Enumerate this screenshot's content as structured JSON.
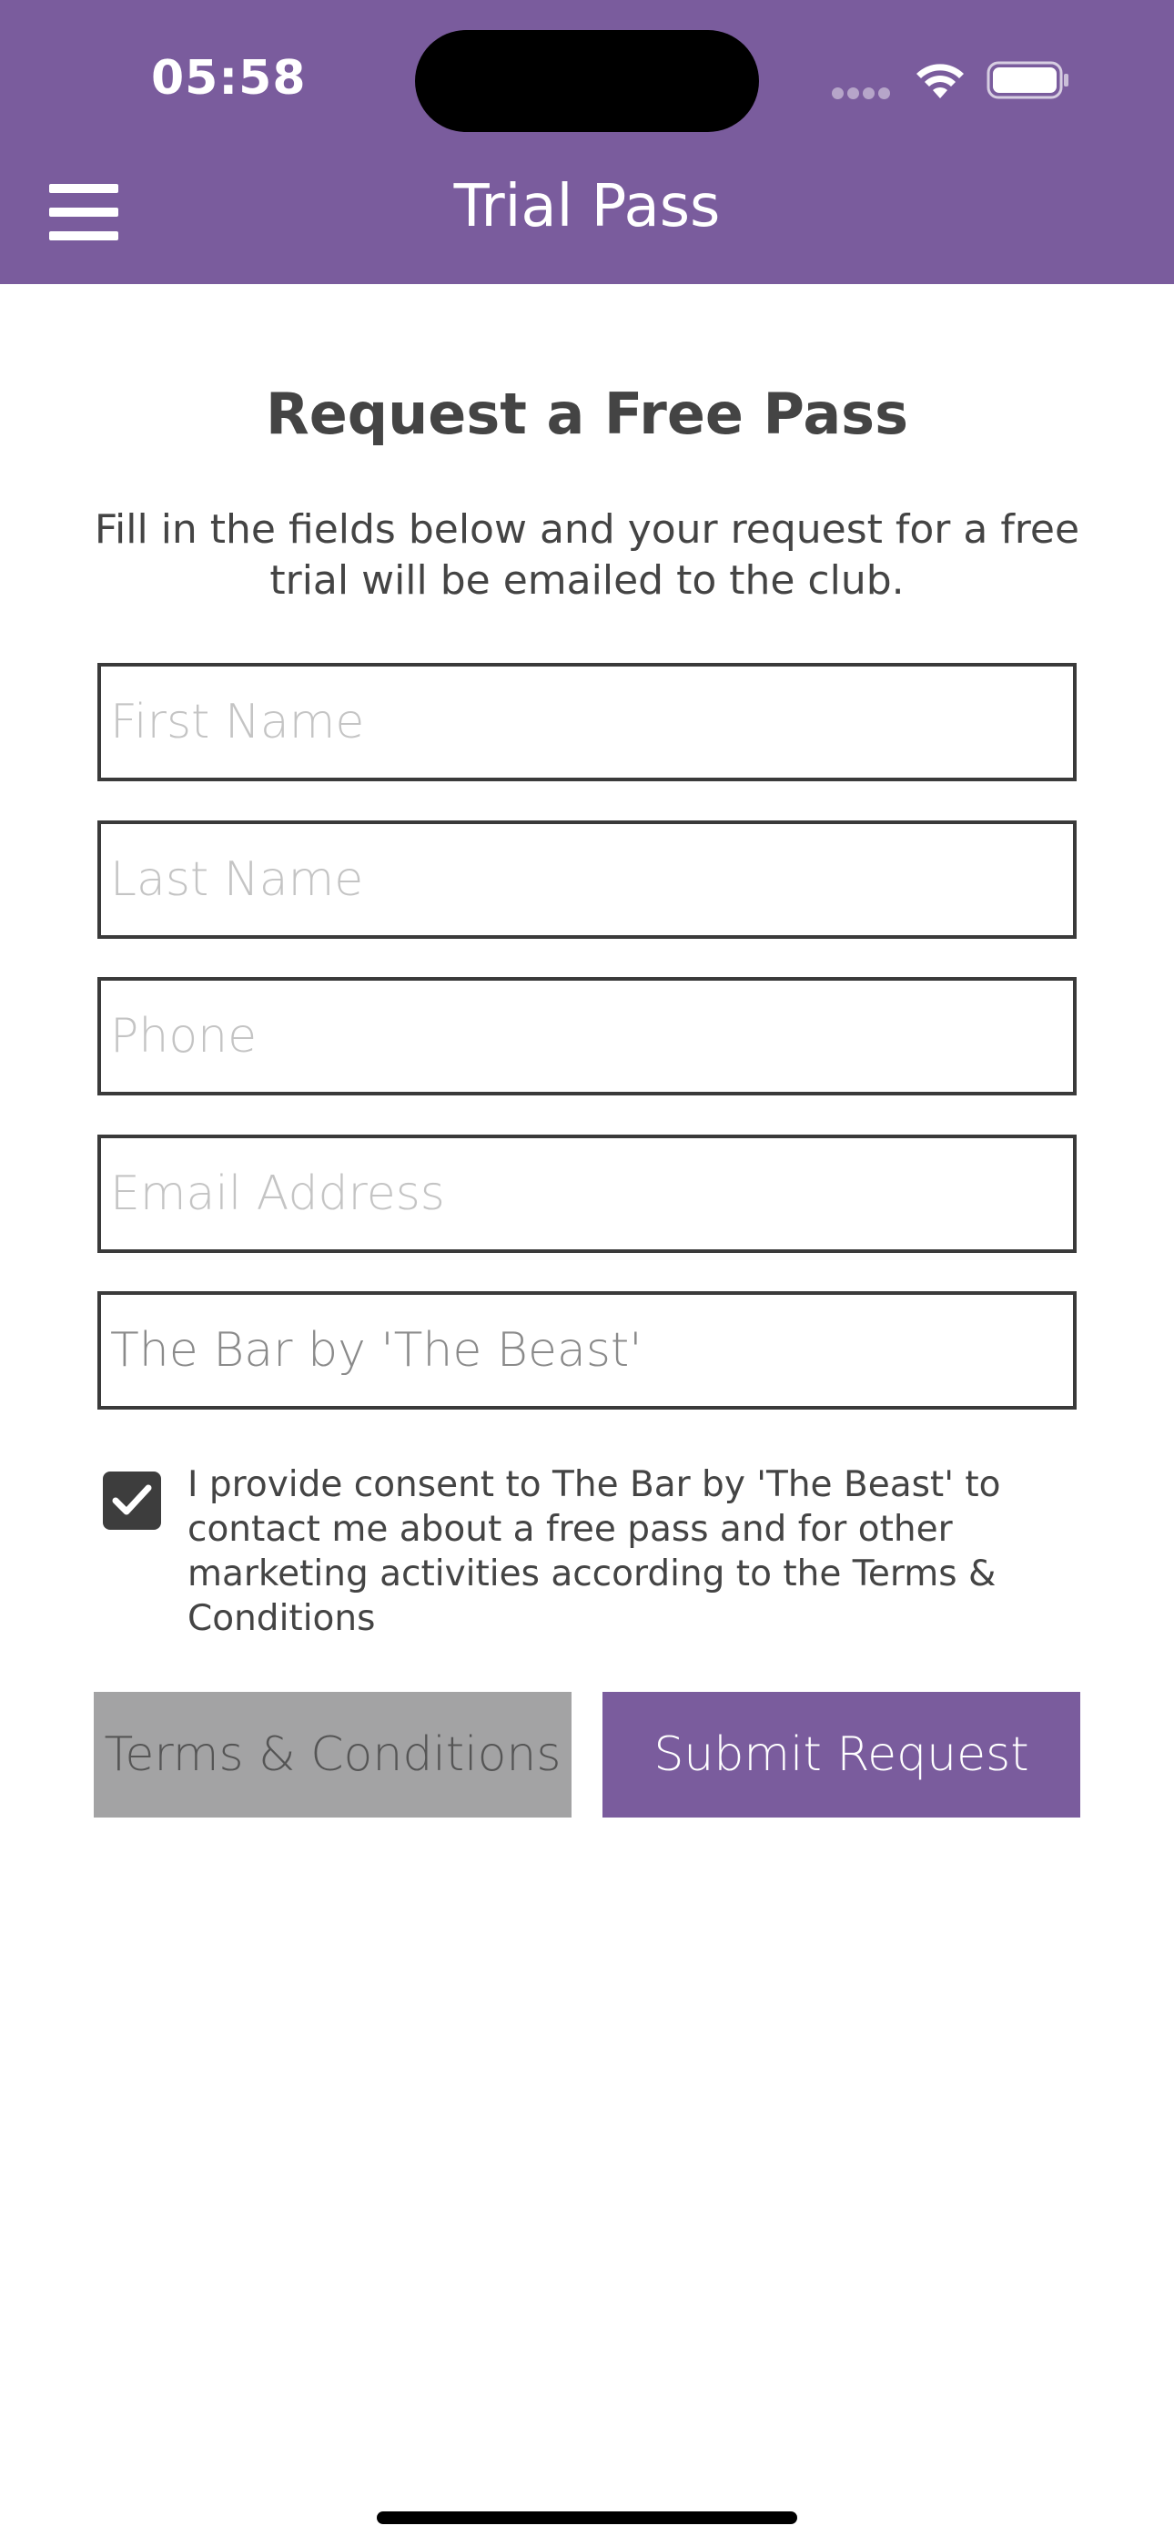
{
  "status_bar": {
    "time": "05:58"
  },
  "header": {
    "title": "Trial Pass",
    "menu_icon": "hamburger-menu-icon",
    "background_color": "#7a5c9d"
  },
  "form": {
    "heading": "Request a Free Pass",
    "intro": "Fill in the fields below and your request for a free trial will be emailed to the club.",
    "fields": {
      "first_name_placeholder": "First Name",
      "last_name_placeholder": "Last Name",
      "phone_placeholder": "Phone",
      "email_placeholder": "Email Address",
      "club_value": "The Bar by 'The Beast'"
    },
    "consent": {
      "checked": true,
      "text": "I provide consent to The Bar by 'The Beast' to contact me about a free pass and for other marketing activities according to the Terms & Conditions"
    },
    "buttons": {
      "terms_label": "Terms & Conditions",
      "submit_label": "Submit Request"
    }
  },
  "colors": {
    "accent": "#7a5c9d",
    "secondary_button": "#a3a3a4",
    "text": "#444444"
  }
}
